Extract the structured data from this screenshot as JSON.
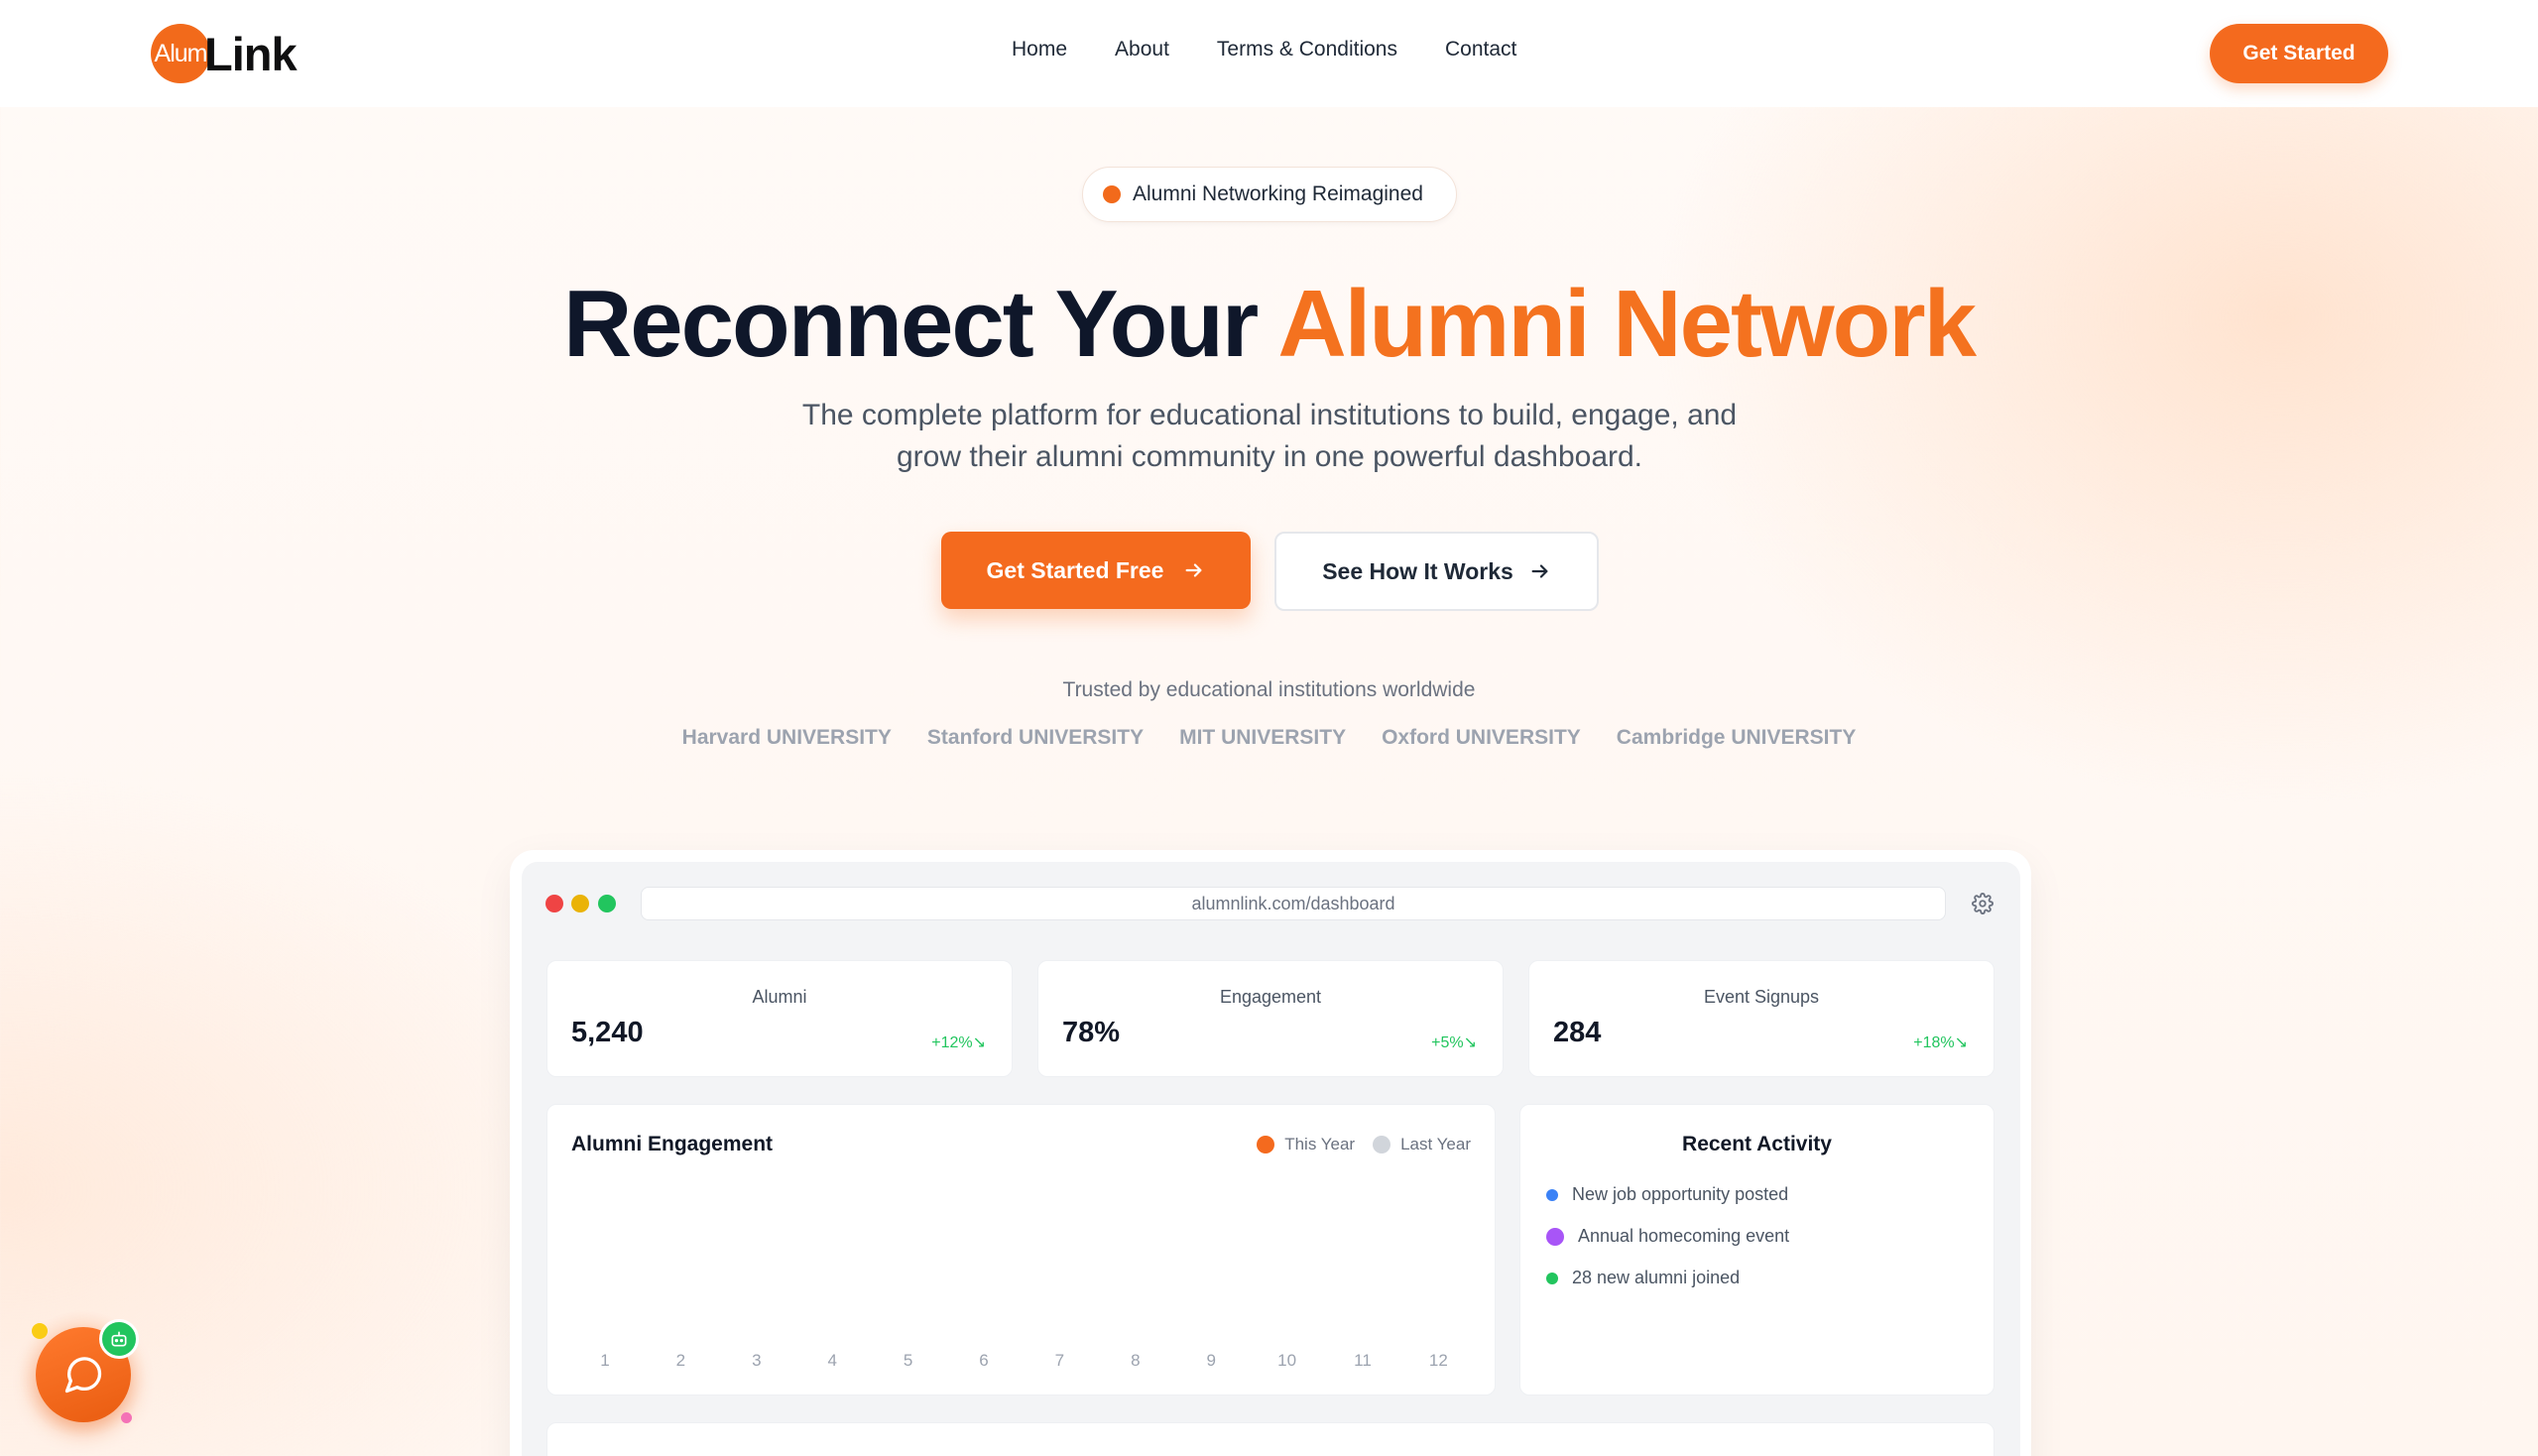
{
  "brand": {
    "badge": "Alum",
    "name": "Link",
    "accent_color": "#f46a1e"
  },
  "nav": {
    "items": [
      {
        "label": "Home"
      },
      {
        "label": "About"
      },
      {
        "label": "Terms & Conditions"
      },
      {
        "label": "Contact"
      }
    ],
    "cta_label": "Get Started"
  },
  "hero": {
    "pill": "Alumni Networking Reimagined",
    "headline_main": "Reconnect Your ",
    "headline_accent": "Alumni Network",
    "subtitle": "The complete platform for educational institutions to build, engage, and grow their alumni community in one powerful dashboard.",
    "primary_cta": "Get Started Free",
    "secondary_cta": "See How It Works",
    "trusted_text": "Trusted by educational institutions worldwide",
    "universities": [
      "Harvard UNIVERSITY",
      "Stanford UNIVERSITY",
      "MIT UNIVERSITY",
      "Oxford UNIVERSITY",
      "Cambridge UNIVERSITY"
    ]
  },
  "dashboard": {
    "url": "alumnlink.com/dashboard",
    "stats": [
      {
        "label": "Alumni",
        "value": "5,240",
        "change": "+12%↘"
      },
      {
        "label": "Engagement",
        "value": "78%",
        "change": "+5%↘"
      },
      {
        "label": "Event Signups",
        "value": "284",
        "change": "+18%↘"
      }
    ],
    "engagement_chart": {
      "title": "Alumni Engagement",
      "legend": [
        {
          "label": "This Year",
          "color": "#f46a1e"
        },
        {
          "label": "Last Year",
          "color": "#d1d5db"
        }
      ],
      "x_labels": [
        "1",
        "2",
        "3",
        "4",
        "5",
        "6",
        "7",
        "8",
        "9",
        "10",
        "11",
        "12"
      ]
    },
    "recent_activity": {
      "title": "Recent Activity",
      "items": [
        {
          "text": "New job opportunity posted",
          "color": "#3b82f6"
        },
        {
          "text": "Annual homecoming event",
          "color": "#a855f7"
        },
        {
          "text": "28 new alumni joined",
          "color": "#22c55e"
        }
      ]
    }
  }
}
